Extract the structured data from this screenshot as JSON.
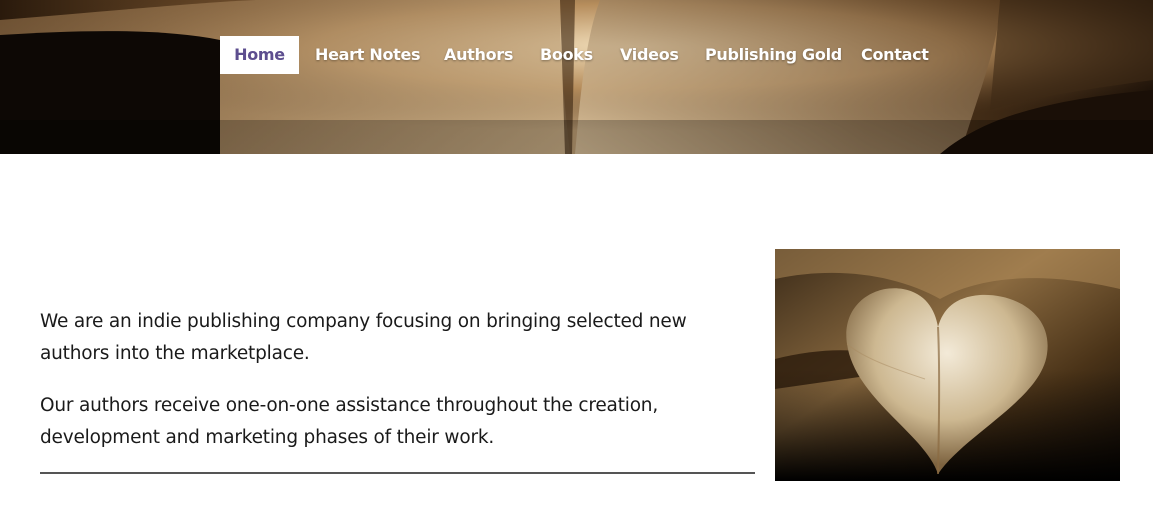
{
  "nav": {
    "items": [
      {
        "label": "Home",
        "active": true
      },
      {
        "label": "Heart Notes",
        "active": false
      },
      {
        "label": "Authors",
        "active": false
      },
      {
        "label": "Books",
        "active": false
      },
      {
        "label": "Videos",
        "active": false
      },
      {
        "label": "Publishing Gold",
        "active": false
      },
      {
        "label": "Contact",
        "active": false
      }
    ]
  },
  "hero": {
    "image": "open-book-pages-photo"
  },
  "main": {
    "paragraphs": [
      "We are an indie publishing company focusing on bringing selected new authors into the marketplace.",
      "Our authors receive one-on-one assistance throughout the creation, development and marketing phases of their work."
    ],
    "image": "heart-shaped-book-pages-photo"
  },
  "colors": {
    "active_nav_text": "#5d4e8f",
    "nav_text": "#ffffff",
    "body_text": "#1a1a1a",
    "rule": "#555555"
  }
}
